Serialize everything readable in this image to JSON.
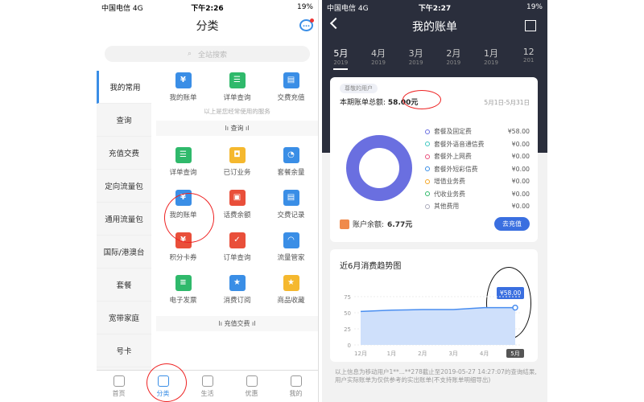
{
  "left": {
    "status": {
      "carrier": "中国电信 4G",
      "time": "下午2:26",
      "battery": "19%"
    },
    "title": "分类",
    "search_placeholder": "全站搜索",
    "sidebar": [
      "我的常用",
      "查询",
      "充值交费",
      "定向流量包",
      "通用流量包",
      "国际/港澳台",
      "套餐",
      "宽带家庭",
      "号卡"
    ],
    "top_items": [
      {
        "label": "我的账单",
        "icon": "yen-icon",
        "color": "#3a8ee6"
      },
      {
        "label": "详单查询",
        "icon": "list-icon",
        "color": "#2fb96b"
      },
      {
        "label": "交费充值",
        "icon": "card-icon",
        "color": "#3a8ee6"
      }
    ],
    "note": "以上是您经常使用的服务",
    "section_query": "查询",
    "query_items": [
      {
        "label": "详单查询",
        "icon": "list-icon",
        "color": "#2fb96b"
      },
      {
        "label": "已订业务",
        "icon": "bag-icon",
        "color": "#f5b82e"
      },
      {
        "label": "套餐余量",
        "icon": "pie-icon",
        "color": "#3a8ee6"
      },
      {
        "label": "我的账单",
        "icon": "yen-icon",
        "color": "#3a8ee6"
      },
      {
        "label": "话费余额",
        "icon": "wallet-icon",
        "color": "#e94f3a"
      },
      {
        "label": "交费记录",
        "icon": "card-icon",
        "color": "#3a8ee6"
      },
      {
        "label": "积分卡券",
        "icon": "coupon-icon",
        "color": "#e94f3a"
      },
      {
        "label": "订单查询",
        "icon": "clipboard-icon",
        "color": "#e94f3a"
      },
      {
        "label": "流量管家",
        "icon": "gauge-icon",
        "color": "#3a8ee6"
      },
      {
        "label": "电子发票",
        "icon": "invoice-icon",
        "color": "#2fb96b"
      },
      {
        "label": "消费订阅",
        "icon": "star-badge-icon",
        "color": "#3a8ee6"
      },
      {
        "label": "商品收藏",
        "icon": "star-icon",
        "color": "#f5b82e"
      }
    ],
    "section_pay": "充值交费",
    "tabs": [
      "首页",
      "分类",
      "生活",
      "优惠",
      "我的"
    ]
  },
  "right": {
    "status": {
      "carrier": "中国电信 4G",
      "time": "下午2:27",
      "battery": "19%"
    },
    "title": "我的账单",
    "months": [
      {
        "m": "5月",
        "y": "2019"
      },
      {
        "m": "4月",
        "y": "2019"
      },
      {
        "m": "3月",
        "y": "2019"
      },
      {
        "m": "2月",
        "y": "2019"
      },
      {
        "m": "1月",
        "y": "2019"
      },
      {
        "m": "12",
        "y": "201"
      }
    ],
    "badge": "尊敬的用户",
    "total_label": "本期账单总额:",
    "total_value": "58.00元",
    "period": "5月1日-5月31日",
    "items": [
      {
        "name": "套餐及固定费",
        "amount": "¥58.00",
        "color": "#6a6fe0"
      },
      {
        "name": "套餐外语音通信费",
        "amount": "¥0.00",
        "color": "#3ec7c0"
      },
      {
        "name": "套餐外上网费",
        "amount": "¥0.00",
        "color": "#e94f7a"
      },
      {
        "name": "套餐外短彩信费",
        "amount": "¥0.00",
        "color": "#3a8ee6"
      },
      {
        "name": "增值业务费",
        "amount": "¥0.00",
        "color": "#f5a623"
      },
      {
        "name": "代收业务费",
        "amount": "¥0.00",
        "color": "#2fb96b"
      },
      {
        "name": "其他费用",
        "amount": "¥0.00",
        "color": "#aab"
      }
    ],
    "balance_label": "账户余额:",
    "balance_value": "6.77元",
    "recharge": "去充值",
    "chart_title": "近6月消费趋势图",
    "tooltip": "¥58.00",
    "footer": "以上信息为移动用户1**...**278截止至2019-05-27 14:27:07的查询结果,用户实际账单为仅供参考的实出账单(不支持账单明细导出)"
  },
  "chart_data": {
    "type": "area",
    "categories": [
      "12月",
      "1月",
      "2月",
      "3月",
      "4月",
      "5月"
    ],
    "values": [
      52,
      54,
      55,
      55,
      58,
      58
    ],
    "ylim": [
      0,
      75
    ],
    "yticks": [
      0,
      25,
      50,
      75
    ],
    "grid": true
  }
}
